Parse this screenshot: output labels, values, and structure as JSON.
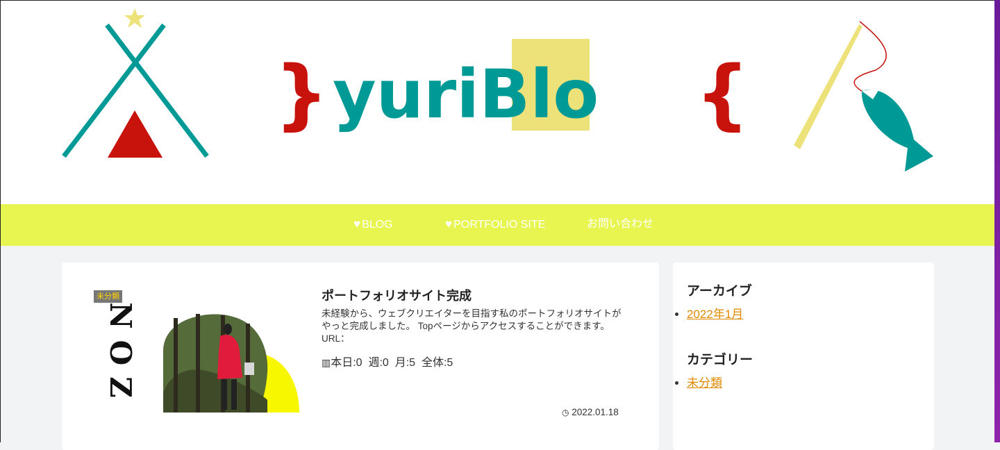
{
  "header": {
    "logo_text": "yuriBlo",
    "colors": {
      "teal": "#009a96",
      "yellow": "#ede17a",
      "red": "#c8120c",
      "nav_bg": "#e8f550",
      "link": "#e08a00"
    }
  },
  "nav": {
    "items": [
      {
        "label": "BLOG",
        "icon": "heart-icon"
      },
      {
        "label": "PORTFOLIO SITE",
        "icon": "heart-icon"
      },
      {
        "label": "お問い合わせ"
      }
    ]
  },
  "post": {
    "category": "未分類",
    "title": "ポートフォリオサイト完成",
    "excerpt": "未経験から、ウェブクリエイターを目指す私のポートフォリオサイトがやっと完成しました。 Topページからアクセスすることができます。 URL：",
    "views": "本日:0  週:0  月:5  全体:5",
    "date": "2022.01.18",
    "thumb_text": "NOZ"
  },
  "sidebar": {
    "archive_title": "アーカイブ",
    "archive_items": [
      "2022年1月"
    ],
    "category_title": "カテゴリー",
    "category_items": [
      "未分類"
    ]
  }
}
